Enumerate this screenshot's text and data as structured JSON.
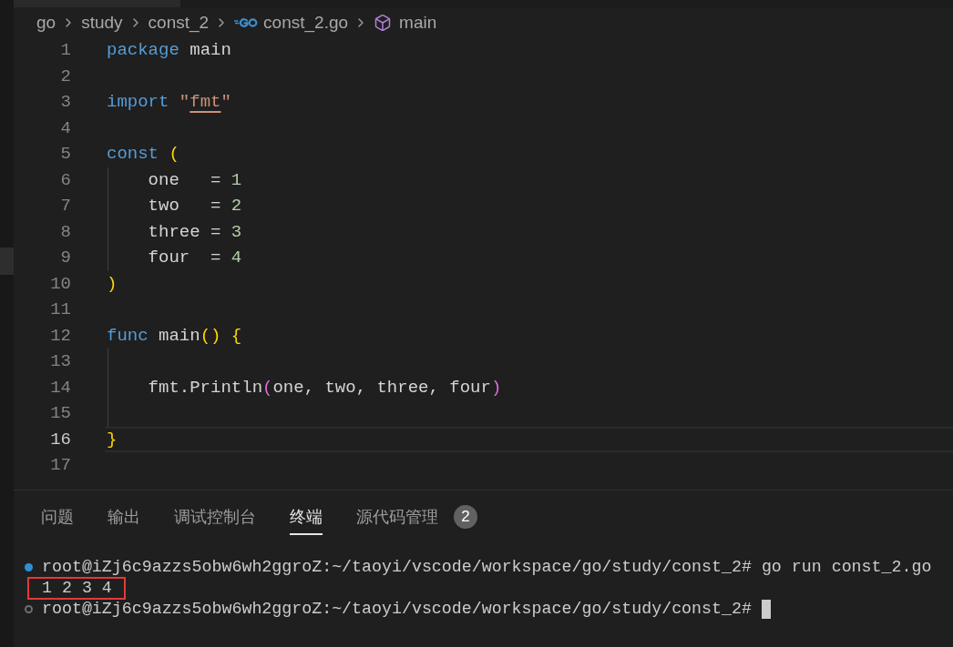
{
  "breadcrumbs": [
    {
      "label": "go",
      "kind": "folder"
    },
    {
      "label": "study",
      "kind": "folder"
    },
    {
      "label": "const_2",
      "kind": "folder"
    },
    {
      "label": "const_2.go",
      "kind": "file"
    },
    {
      "label": "main",
      "kind": "symbol"
    }
  ],
  "editor": {
    "lines": [
      {
        "number": "1",
        "selected": false,
        "indent_guide": false,
        "tokens": [
          {
            "kind": "keyword",
            "text": "package"
          },
          {
            "kind": "plain",
            "text": " main"
          }
        ]
      },
      {
        "number": "2",
        "selected": false,
        "indent_guide": false
      },
      {
        "number": "3",
        "selected": false,
        "indent_guide": false,
        "tokens": [
          {
            "kind": "keyword",
            "text": "import"
          },
          {
            "kind": "string",
            "text": " \""
          },
          {
            "kind": "string-link",
            "text": "fmt"
          },
          {
            "kind": "string",
            "text": "\""
          }
        ]
      },
      {
        "number": "4",
        "selected": false,
        "indent_guide": false
      },
      {
        "number": "5",
        "selected": false,
        "indent_guide": false,
        "tokens": [
          {
            "kind": "keyword",
            "text": "const"
          },
          {
            "kind": "bracket-outer",
            "text": " ("
          }
        ]
      },
      {
        "number": "6",
        "selected": false,
        "indent_guide": true,
        "tokens": [
          {
            "kind": "plain",
            "text": "    one   = "
          },
          {
            "kind": "number",
            "text": "1"
          }
        ]
      },
      {
        "number": "7",
        "selected": false,
        "indent_guide": true,
        "tokens": [
          {
            "kind": "plain",
            "text": "    two   = "
          },
          {
            "kind": "number",
            "text": "2"
          }
        ]
      },
      {
        "number": "8",
        "selected": false,
        "indent_guide": true,
        "tokens": [
          {
            "kind": "plain",
            "text": "    three = "
          },
          {
            "kind": "number",
            "text": "3"
          }
        ]
      },
      {
        "number": "9",
        "selected": false,
        "indent_guide": true,
        "tokens": [
          {
            "kind": "plain",
            "text": "    four  = "
          },
          {
            "kind": "number",
            "text": "4"
          }
        ]
      },
      {
        "number": "10",
        "selected": false,
        "indent_guide": false,
        "tokens": [
          {
            "kind": "bracket-outer",
            "text": ")"
          }
        ]
      },
      {
        "number": "11",
        "selected": false,
        "indent_guide": false
      },
      {
        "number": "12",
        "selected": false,
        "indent_guide": false,
        "tokens": [
          {
            "kind": "keyword",
            "text": "func"
          },
          {
            "kind": "plain",
            "text": " main"
          },
          {
            "kind": "bracket-outer",
            "text": "() {"
          }
        ]
      },
      {
        "number": "13",
        "selected": false,
        "indent_guide": true
      },
      {
        "number": "14",
        "selected": false,
        "indent_guide": true,
        "tokens": [
          {
            "kind": "plain",
            "text": "    fmt.Println"
          },
          {
            "kind": "bracket-inner",
            "text": "("
          },
          {
            "kind": "plain",
            "text": "one, two, three, four"
          },
          {
            "kind": "bracket-inner",
            "text": ")"
          }
        ]
      },
      {
        "number": "15",
        "selected": false,
        "indent_guide": true
      },
      {
        "number": "16",
        "selected": true,
        "indent_guide": false,
        "tokens": [
          {
            "kind": "bracket-outer",
            "text": "}"
          }
        ]
      },
      {
        "number": "17",
        "selected": false,
        "indent_guide": false
      }
    ]
  },
  "panel": {
    "tabs": [
      {
        "label": "问题",
        "selected": false
      },
      {
        "label": "输出",
        "selected": false
      },
      {
        "label": "调试控制台",
        "selected": false
      },
      {
        "label": "终端",
        "selected": true
      },
      {
        "label": "源代码管理",
        "selected": false,
        "badge": "2"
      }
    ],
    "terminal": {
      "lines": [
        {
          "kind": "success",
          "text": "root@iZj6c9azzs5obw6wh2ggroZ:~/taoyi/vscode/workspace/go/study/const_2# go run const_2.go",
          "highlighted": false,
          "cursor": false
        },
        {
          "kind": "output",
          "text": "1 2 3 4",
          "highlighted": true,
          "cursor": false
        },
        {
          "kind": "idle",
          "text": "root@iZj6c9azzs5obw6wh2ggroZ:~/taoyi/vscode/workspace/go/study/const_2#",
          "highlighted": false,
          "cursor": true
        }
      ]
    }
  }
}
